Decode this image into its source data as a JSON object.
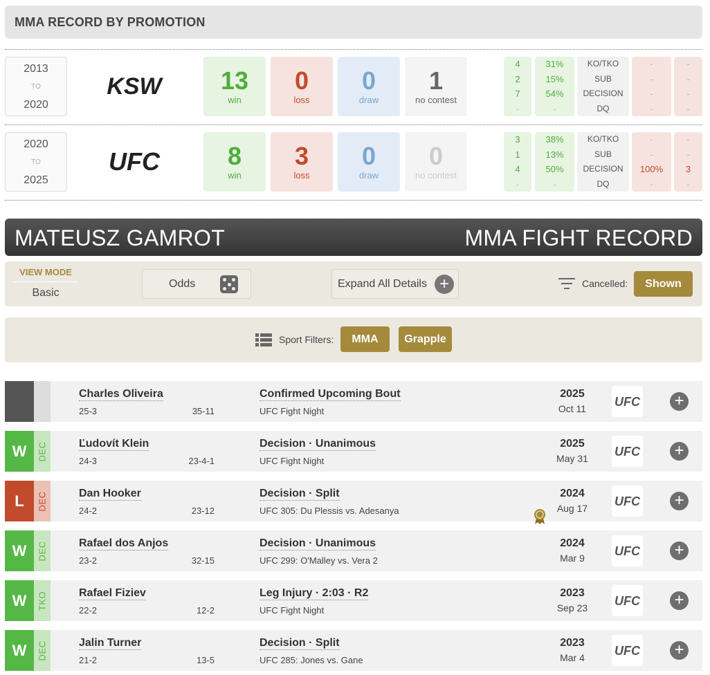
{
  "section_title": "MMA RECORD BY PROMOTION",
  "promotions": [
    {
      "from": "2013",
      "to_label": "TO",
      "to": "2020",
      "org_logo_text": "KSW",
      "win": "13",
      "win_label": "win",
      "loss": "0",
      "loss_label": "loss",
      "draw": "0",
      "draw_label": "draw",
      "nc": "1",
      "nc_label": "no contest",
      "win_methods": {
        "counts": [
          "4",
          "2",
          "7",
          "-"
        ],
        "pcts": [
          "31%",
          "15%",
          "54%",
          "-"
        ]
      },
      "method_labels": [
        "KO/TKO",
        "SUB",
        "DECISION",
        "DQ"
      ],
      "loss_methods": {
        "pcts": [
          "-",
          "-",
          "-",
          "-"
        ],
        "counts": [
          "-",
          "-",
          "-",
          "-"
        ]
      }
    },
    {
      "from": "2020",
      "to_label": "TO",
      "to": "2025",
      "org_logo_text": "UFC",
      "win": "8",
      "win_label": "win",
      "loss": "3",
      "loss_label": "loss",
      "draw": "0",
      "draw_label": "draw",
      "nc": "0",
      "nc_label": "no contest",
      "win_methods": {
        "counts": [
          "3",
          "1",
          "4",
          "-"
        ],
        "pcts": [
          "38%",
          "13%",
          "50%",
          "-"
        ]
      },
      "method_labels": [
        "KO/TKO",
        "SUB",
        "DECISION",
        "DQ"
      ],
      "loss_methods": {
        "pcts": [
          "-",
          "-",
          "100%",
          "-"
        ],
        "counts": [
          "-",
          "-",
          "3",
          "-"
        ]
      }
    }
  ],
  "banner": {
    "name": "MATEUSZ GAMROT",
    "right": "MMA FIGHT RECORD"
  },
  "toolbar": {
    "view_mode_label": "VIEW MODE",
    "view_mode_value": "Basic",
    "odds_label": "Odds",
    "expand_label": "Expand All Details",
    "cancelled_label": "Cancelled:",
    "shown_label": "Shown"
  },
  "sport_filters": {
    "label": "Sport Filters:",
    "options": [
      "MMA",
      "Grapple"
    ]
  },
  "fights": [
    {
      "result": "",
      "method_tag": "",
      "opponent": "Charles Oliveira",
      "record_a": "25-3",
      "record_b": "35-11",
      "outcome": "Confirmed Upcoming Bout",
      "event": "UFC Fight Night",
      "year": "2025",
      "date": "Oct 11",
      "org": "UFC"
    },
    {
      "result": "W",
      "method_tag": "DEC",
      "opponent": "Ľudovít Klein",
      "record_a": "24-3",
      "record_b": "23-4-1",
      "outcome": "Decision · Unanimous",
      "event": "UFC Fight Night",
      "year": "2025",
      "date": "May 31",
      "org": "UFC"
    },
    {
      "result": "L",
      "method_tag": "DEC",
      "opponent": "Dan Hooker",
      "record_a": "24-2",
      "record_b": "23-12",
      "outcome": "Decision · Split",
      "event": "UFC 305: Du Plessis vs. Adesanya",
      "year": "2024",
      "date": "Aug 17",
      "org": "UFC"
    },
    {
      "result": "W",
      "method_tag": "DEC",
      "opponent": "Rafael dos Anjos",
      "record_a": "23-2",
      "record_b": "32-15",
      "outcome": "Decision · Unanimous",
      "event": "UFC 299: O'Malley vs. Vera 2",
      "year": "2024",
      "date": "Mar 9",
      "org": "UFC"
    },
    {
      "result": "W",
      "method_tag": "TKO",
      "opponent": "Rafael Fiziev",
      "record_a": "22-2",
      "record_b": "12-2",
      "outcome": "Leg Injury · 2:03 · R2",
      "event": "UFC Fight Night",
      "year": "2023",
      "date": "Sep 23",
      "org": "UFC"
    },
    {
      "result": "W",
      "method_tag": "DEC",
      "opponent": "Jalin Turner",
      "record_a": "21-2",
      "record_b": "13-5",
      "outcome": "Decision · Split",
      "event": "UFC 285: Jones vs. Gane",
      "year": "2023",
      "date": "Mar 4",
      "org": "UFC"
    }
  ]
}
